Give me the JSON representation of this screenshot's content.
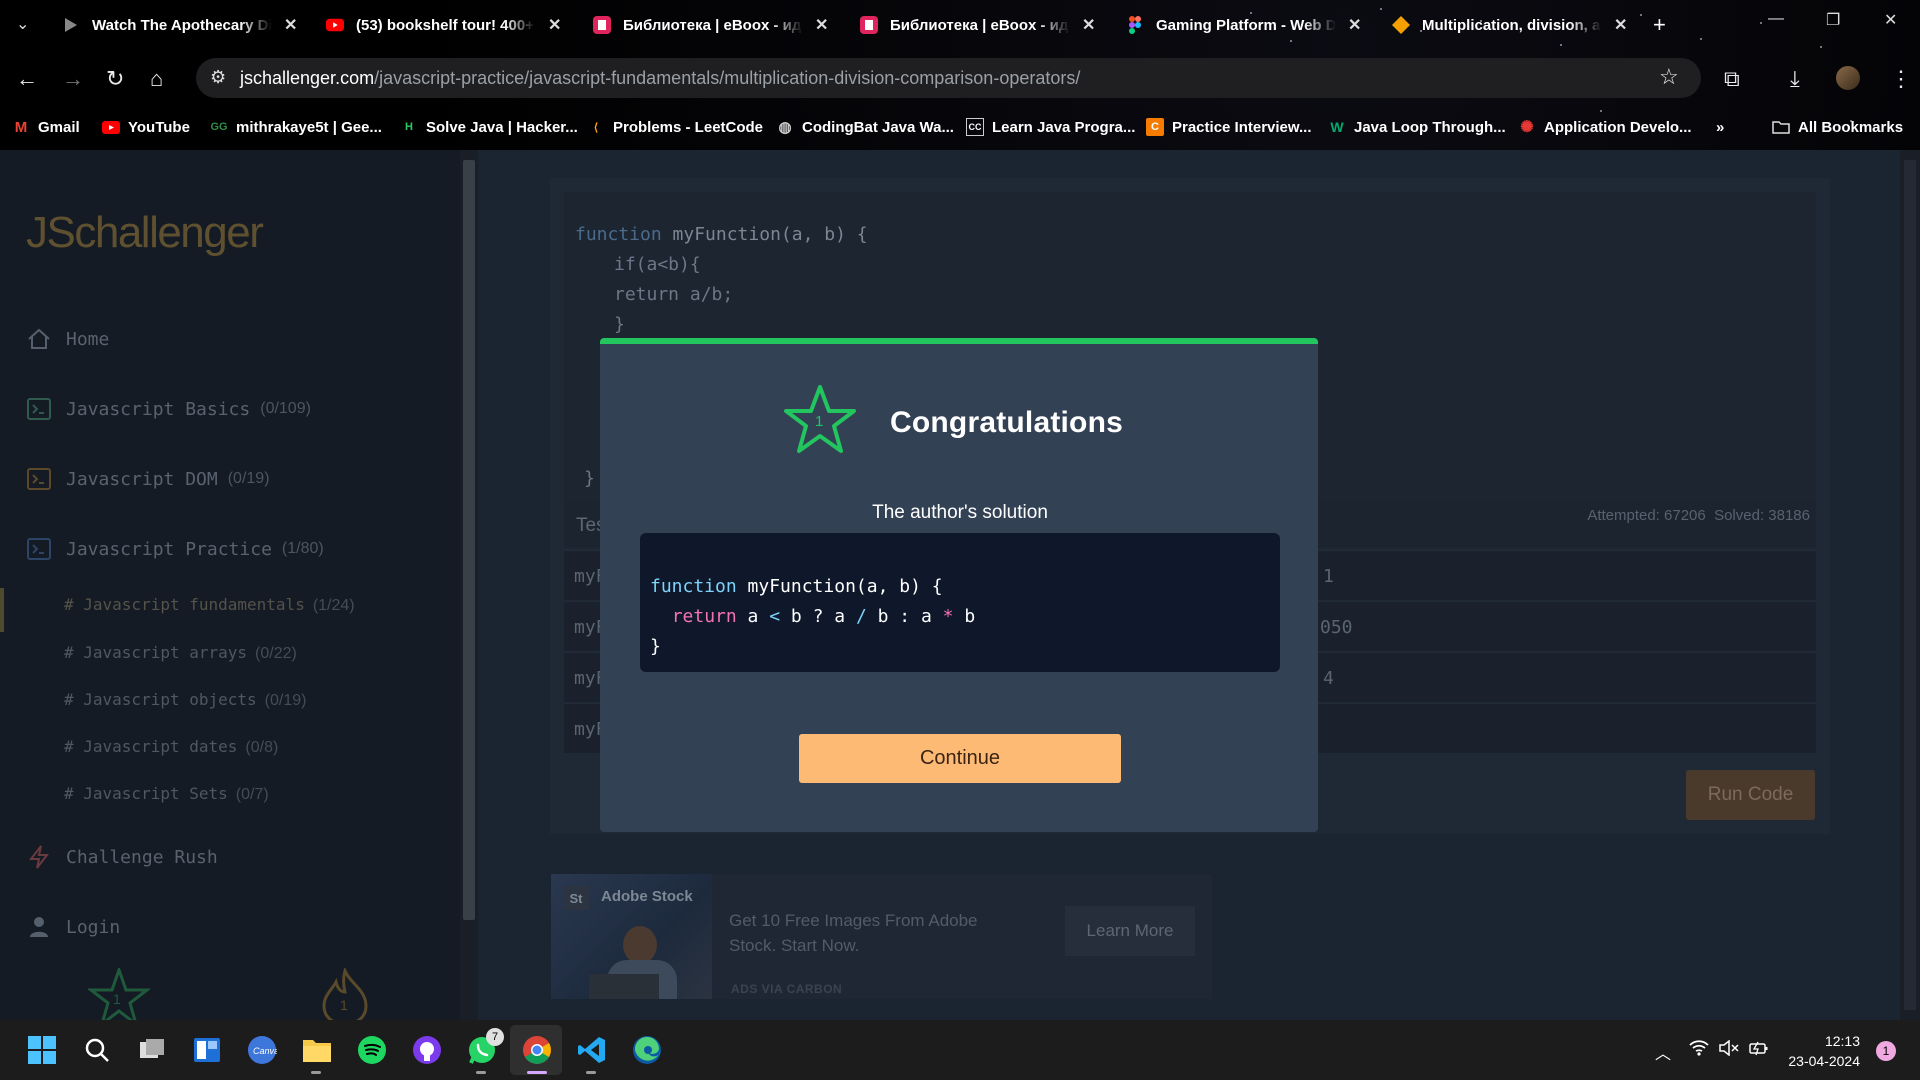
{
  "browser": {
    "tabs": [
      {
        "title": "Watch The Apothecary Di",
        "icon": "play-icon"
      },
      {
        "title": "(53) bookshelf tour! 400+",
        "icon": "youtube-icon"
      },
      {
        "title": "Библиотека | eBoox - иде",
        "icon": "eboox-icon"
      },
      {
        "title": "Библиотека | eBoox - иде",
        "icon": "eboox-icon"
      },
      {
        "title": "Gaming Platform - Web D",
        "icon": "figma-icon"
      },
      {
        "title": "Multiplication, division, ar",
        "icon": "jschallenger-icon"
      }
    ],
    "url_host": "jschallenger.com",
    "url_path": "/javascript-practice/javascript-fundamentals/multiplication-division-comparison-operators/",
    "bookmarks": [
      {
        "label": "Gmail",
        "icon": "gmail-icon"
      },
      {
        "label": "YouTube",
        "icon": "youtube-icon"
      },
      {
        "label": "mithrakaye5t | Gee...",
        "icon": "geeksforgeeks-icon"
      },
      {
        "label": "Solve Java | Hacker...",
        "icon": "hackerrank-icon"
      },
      {
        "label": "Problems - LeetCode",
        "icon": "leetcode-icon"
      },
      {
        "label": "CodingBat Java Wa...",
        "icon": "globe-icon"
      },
      {
        "label": "Learn Java Progra...",
        "icon": "cc-icon"
      },
      {
        "label": "Practice Interview...",
        "icon": "practice-icon"
      },
      {
        "label": "Java Loop Through...",
        "icon": "w3schools-icon"
      },
      {
        "label": "Application Develo...",
        "icon": "oracle-icon"
      }
    ],
    "all_bookmarks": "All Bookmarks"
  },
  "sidebar": {
    "logo": "JSchallenger",
    "home": "Home",
    "sections": [
      {
        "label": "Javascript Basics",
        "count": "(0/109)"
      },
      {
        "label": "Javascript DOM",
        "count": "(0/19)"
      },
      {
        "label": "Javascript Practice",
        "count": "(1/80)"
      }
    ],
    "subsections": [
      {
        "label": "# Javascript fundamentals",
        "count": "(1/24)"
      },
      {
        "label": "# Javascript arrays",
        "count": "(0/22)"
      },
      {
        "label": "# Javascript objects",
        "count": "(0/19)"
      },
      {
        "label": "# Javascript dates",
        "count": "(0/8)"
      },
      {
        "label": "# Javascript Sets",
        "count": "(0/7)"
      }
    ],
    "challenge_rush": "Challenge Rush",
    "login": "Login",
    "star_badge": "1",
    "flame_badge": "1"
  },
  "editor": {
    "line1_kw": "function",
    "line1_rest": " myFunction(a, b) {",
    "line2": "if(a<b){",
    "line3": "return a/b;",
    "line4": "}",
    "closing": "}"
  },
  "tests": {
    "header": "Tes",
    "rows": [
      {
        "prefix": "myF",
        "result": "1"
      },
      {
        "prefix": "myF",
        "result": "050"
      },
      {
        "prefix": "myF",
        "result": "4"
      },
      {
        "prefix": "myF",
        "result": ""
      }
    ],
    "attempted": "Attempted: 67206",
    "solved": "Solved: 38186",
    "run_button": "Run Code"
  },
  "ad": {
    "brand": "Adobe Stock",
    "logo_text": "St",
    "text": "Get 10 Free Images From Adobe Stock. Start Now.",
    "button": "Learn More",
    "via": "ADS VIA CARBON"
  },
  "modal": {
    "badge": "1",
    "title": "Congratulations",
    "solution_label": "The author's solution",
    "code": {
      "l1_kw": "function",
      "l1_rest": " myFunction(a, b) {",
      "l2_ret": "return",
      "l2_a": " a ",
      "l2_op1": "<",
      "l2_b": " b ? a ",
      "l2_op2": "/",
      "l2_c": " b : a ",
      "l2_op3": "*",
      "l2_d": " b",
      "l3": "}"
    },
    "continue": "Continue"
  },
  "taskbar": {
    "whatsapp_badge": "7",
    "time": "12:13",
    "date": "23-04-2024",
    "notification_count": "1"
  },
  "colors": {
    "accent_green": "#22c55e",
    "continue_orange": "#fdba74",
    "modal_bg": "#334155",
    "code_bg": "#0f172a"
  }
}
